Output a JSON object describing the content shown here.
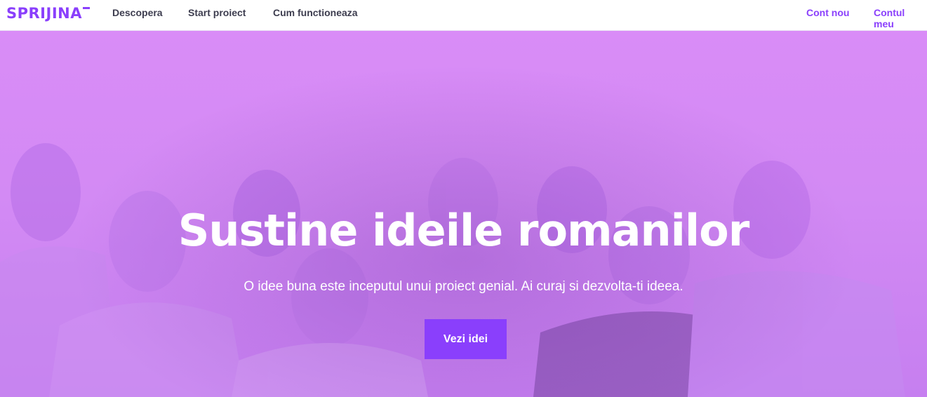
{
  "colors": {
    "brand": "#8a3ffc",
    "hero_tint": "#d98cf7"
  },
  "header": {
    "logo": "SPRIJINA",
    "nav_left": [
      "Descopera",
      "Start proiect",
      "Cum functioneaza"
    ],
    "nav_right": [
      "Cont nou",
      "Contul meu"
    ]
  },
  "hero": {
    "title": "Sustine ideile romanilor",
    "subtitle": "O idee buna este inceputul unui proiect genial. Ai curaj si dezvolta-ti ideea.",
    "cta_label": "Vezi idei"
  }
}
